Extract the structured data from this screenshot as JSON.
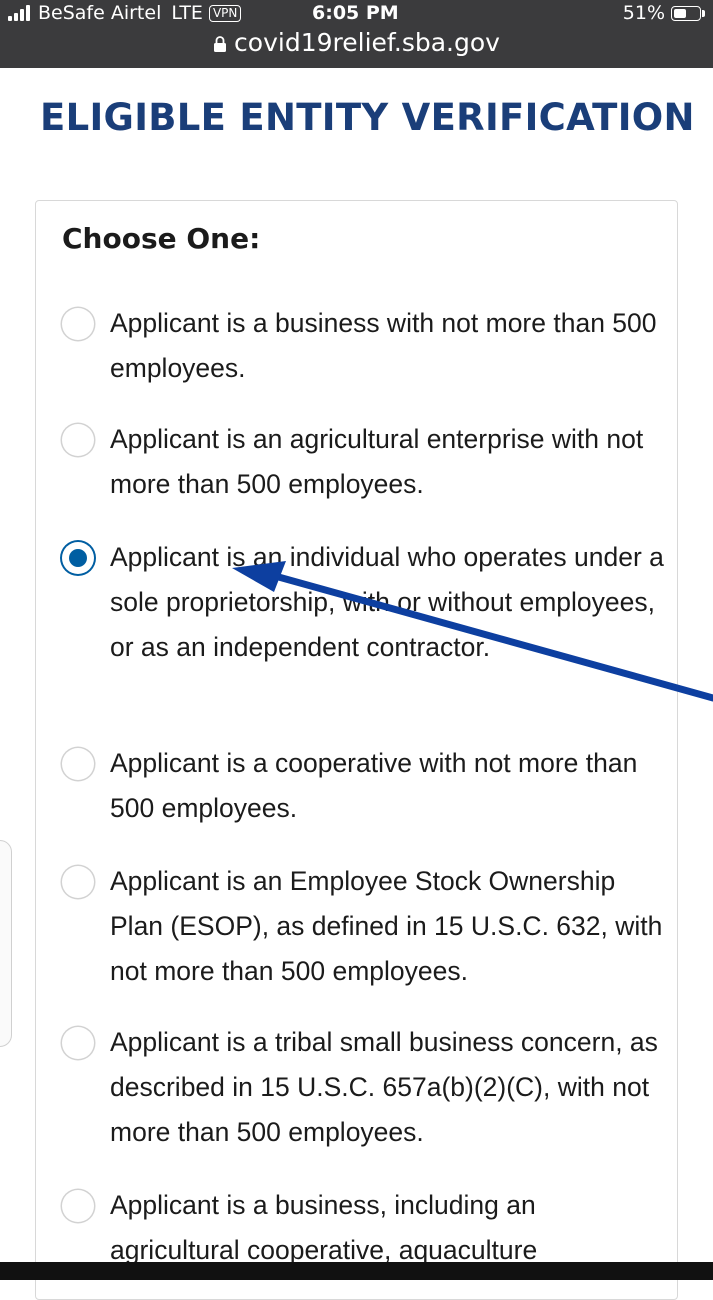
{
  "status_bar": {
    "carrier": "BeSafe Airtel",
    "network": "LTE",
    "vpn": "VPN",
    "time": "6:05 PM",
    "battery": "51%",
    "battery_level": 0.51,
    "url": "covid19relief.sba.gov"
  },
  "page": {
    "title": "ELIGIBLE ENTITY VERIFICATION",
    "choose_label": "Choose One:",
    "selected_index": 2,
    "options": [
      {
        "text": "Applicant is a business with not more than 500 employees.",
        "checked": false
      },
      {
        "text": "Applicant is an agricultural enterprise with not more than 500 employees.",
        "checked": false
      },
      {
        "text": "Applicant is an individual who operates under a sole proprietorship, with or without employees, or as an independent contractor.",
        "checked": true
      },
      {
        "text": "Applicant is a cooperative with not more than 500 employees.",
        "checked": false
      },
      {
        "text": "Applicant is an Employee Stock Ownership Plan (ESOP), as defined in 15 U.S.C. 632, with not more than 500 employees.",
        "checked": false
      },
      {
        "text": "Applicant is a tribal small business concern, as described in 15 U.S.C. 657a(b)(2)(C), with not more than 500 employees.",
        "checked": false
      },
      {
        "text": "Applicant is a business, including an agricultural cooperative, aquaculture",
        "checked": false
      }
    ]
  },
  "colors": {
    "title": "#1a3e79",
    "radio_selected": "#005ea2",
    "annotation_arrow": "#0d3fa0",
    "status_bar_bg": "#3b3b3d"
  }
}
